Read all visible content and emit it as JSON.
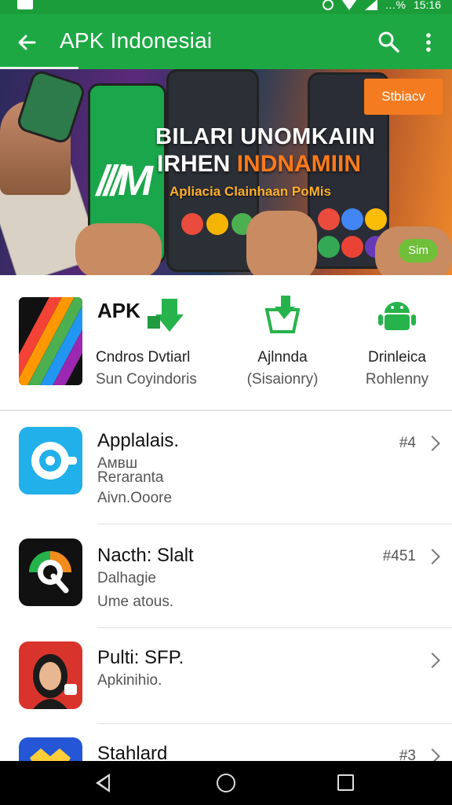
{
  "status_bar": {
    "battery_text": "…%",
    "time": "15:16"
  },
  "app_bar": {
    "title": "APK Indonesiai"
  },
  "banner": {
    "headline_line1": "BILARI UNOMKAIIN",
    "headline_line2_white": "IRHEN ",
    "headline_line2_orange": "INDNAMIIN",
    "subheadline": "Apliacia Clainhaan PoMis",
    "badge": "Stbiacv",
    "pager_pill": "Sim"
  },
  "categories": {
    "apk_label": "APK",
    "items": [
      {
        "title": "Cndros Dvtiarl",
        "subtitle": "Sun Coyindoris"
      },
      {
        "title": "Ajlnnda",
        "subtitle": "(Sisaionry)"
      },
      {
        "title": "Drinleica",
        "subtitle": "Rohlenny"
      }
    ]
  },
  "list": [
    {
      "title": "Applalais.",
      "line1": "Aмвш",
      "line2": "Reraranta",
      "line3": "Aivn.Ooore",
      "rank": "#4"
    },
    {
      "title": "Nacth: Slalt",
      "line1": "Dalhagie",
      "line2": "Ume atous.",
      "rank": "#451"
    },
    {
      "title": "Pulti: SFP.",
      "line1": "Apkinihio.",
      "rank": ""
    },
    {
      "title": "Stahlard",
      "rank": "#3"
    }
  ],
  "colors": {
    "primary_green": "#1da843",
    "status_green": "#1b9e3a",
    "badge_orange": "#f47b1f"
  },
  "icons": {
    "back": "arrow-left-icon",
    "search": "search-icon",
    "more": "more-vert-icon",
    "chevron": "chevron-right-icon"
  }
}
